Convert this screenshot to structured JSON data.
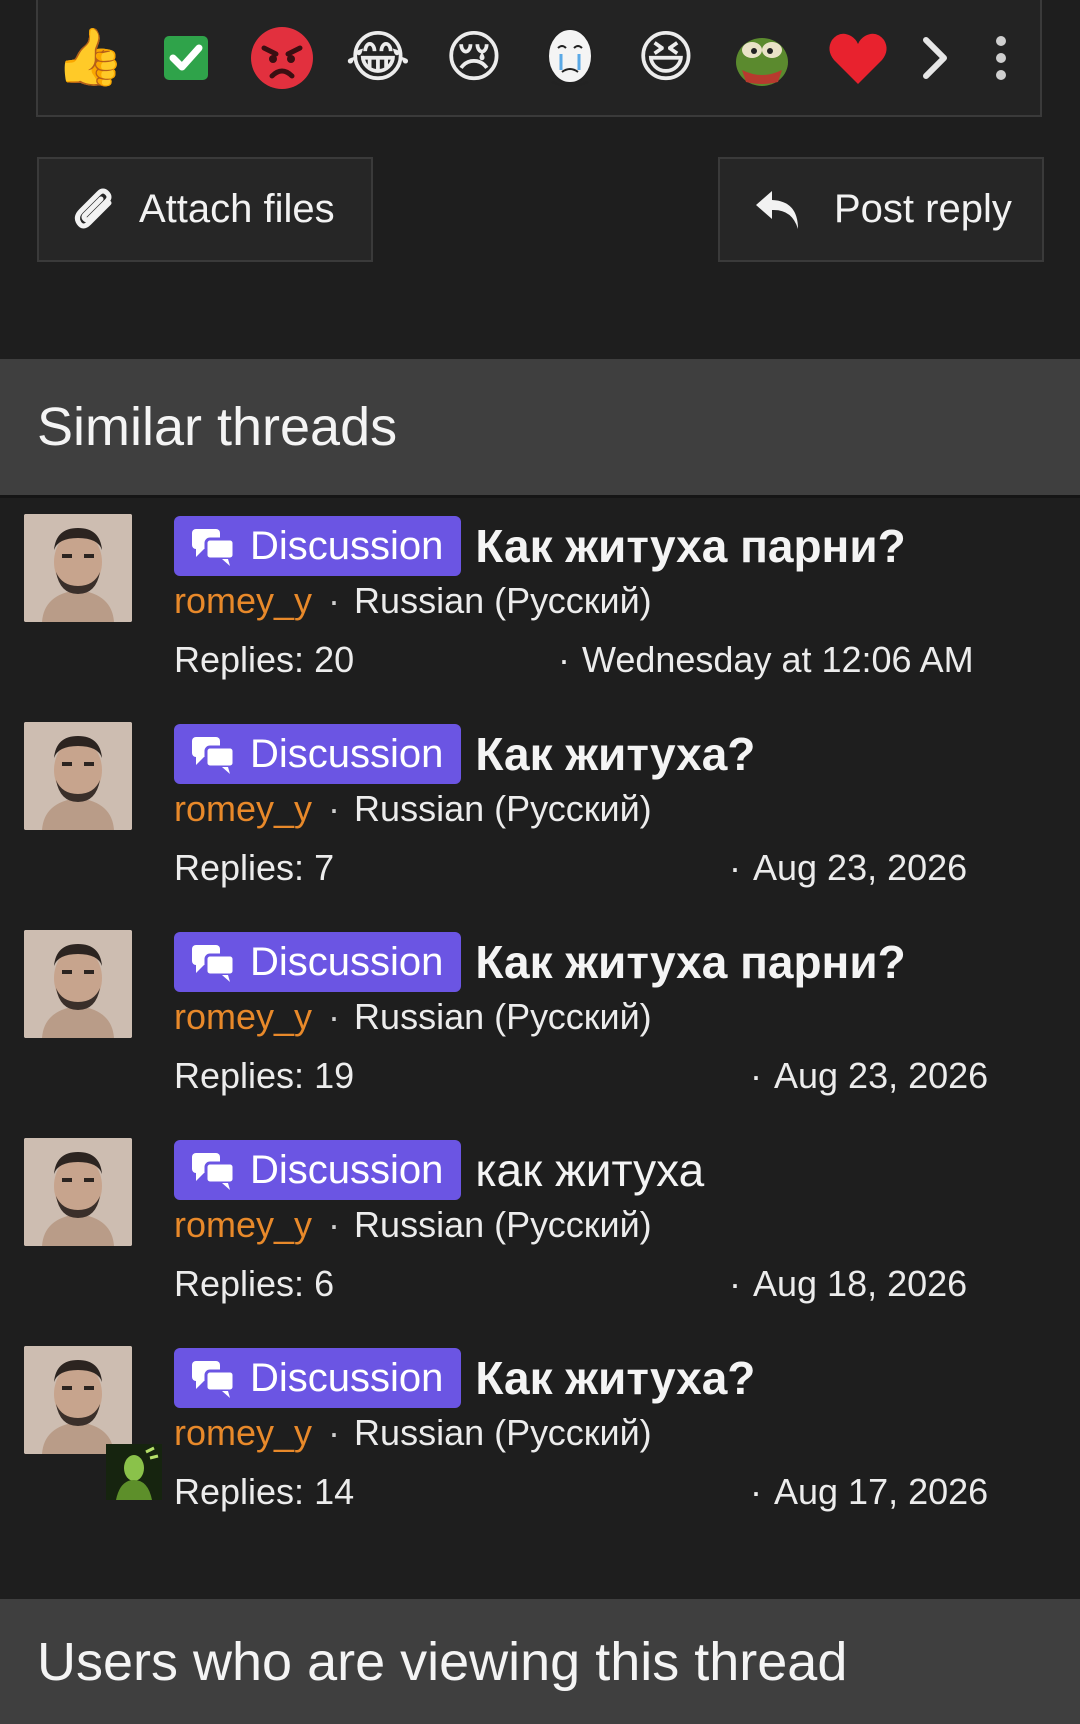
{
  "reactions": [
    {
      "icon": "thumbs-up-icon",
      "glyph": "👍"
    },
    {
      "icon": "check-mark-icon",
      "glyph": ""
    },
    {
      "icon": "angry-face-icon",
      "glyph": ""
    },
    {
      "icon": "crying-laughing-icon",
      "glyph": "😂"
    },
    {
      "icon": "sad-tear-face-icon",
      "glyph": "😢"
    },
    {
      "icon": "crying-wojak-icon",
      "glyph": ""
    },
    {
      "icon": "grinning-squint-icon",
      "glyph": "😆"
    },
    {
      "icon": "angry-pepe-icon",
      "glyph": ""
    },
    {
      "icon": "heart-icon",
      "glyph": "❤"
    }
  ],
  "actions": {
    "attach_label": "Attach files",
    "post_reply_label": "Post reply"
  },
  "similar": {
    "heading": "Similar threads",
    "threads": [
      {
        "prefix": "Discussion",
        "title": "Как житуха парни?",
        "author": "romey_y",
        "separator": "·",
        "forum": "Russian (Русский)",
        "replies": "Replies: 20",
        "date": "Wednesday at 12:06 AM"
      },
      {
        "prefix": "Discussion",
        "title": "Как житуха?",
        "author": "romey_y",
        "separator": "·",
        "forum": "Russian (Русский)",
        "replies": "Replies: 7",
        "date": "Aug 23, 2026"
      },
      {
        "prefix": "Discussion",
        "title": "Как житуха парни?",
        "author": "romey_y",
        "separator": "·",
        "forum": "Russian (Русский)",
        "replies": "Replies: 19",
        "date": "Aug 23, 2026"
      },
      {
        "prefix": "Discussion",
        "title": "как житуха",
        "author": "romey_y",
        "separator": "·",
        "forum": "Russian (Русский)",
        "replies": "Replies: 6",
        "date": "Aug 18, 2026"
      },
      {
        "prefix": "Discussion",
        "title": "Как житуха?",
        "author": "romey_y",
        "separator": "·",
        "forum": "Russian (Русский)",
        "replies": "Replies: 14",
        "date": "Aug 17, 2026"
      }
    ]
  },
  "users_viewing": {
    "heading": "Users who are viewing this thread"
  },
  "colors": {
    "background": "#1e1e1e",
    "section_header": "#3f3f3f",
    "badge": "#6b55e3",
    "author": "#e8892a"
  }
}
